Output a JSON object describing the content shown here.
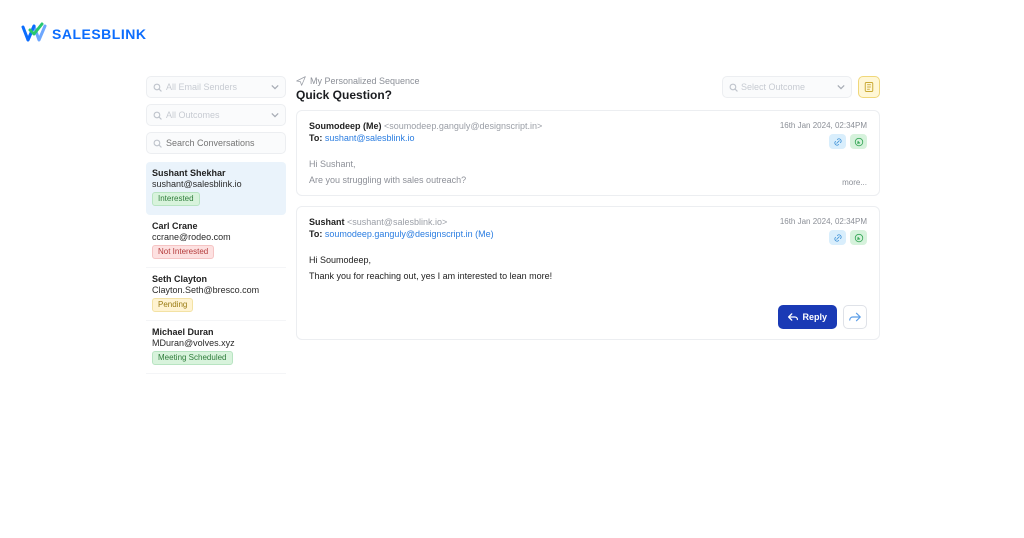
{
  "brand": {
    "name": "SALESBLINK"
  },
  "sidebar": {
    "filter1_placeholder": "All Email Senders",
    "filter2_placeholder": "All Outcomes",
    "search_placeholder": "Search Conversations",
    "contacts": [
      {
        "name": "Sushant Shekhar",
        "email": "sushant@salesblink.io",
        "status": "Interested",
        "status_class": "b-interested",
        "selected": true
      },
      {
        "name": "Carl Crane",
        "email": "ccrane@rodeo.com",
        "status": "Not Interested",
        "status_class": "b-notinterested",
        "selected": false
      },
      {
        "name": "Seth Clayton",
        "email": "Clayton.Seth@bresco.com",
        "status": "Pending",
        "status_class": "b-pending",
        "selected": false
      },
      {
        "name": "Michael Duran",
        "email": "MDuran@volves.xyz",
        "status": "Meeting Scheduled",
        "status_class": "b-meeting",
        "selected": false
      }
    ]
  },
  "main": {
    "breadcrumb": "My Personalized Sequence",
    "subject": "Quick Question?",
    "outcome_placeholder": "Select Outcome",
    "messages": [
      {
        "from_name": "Soumodeep (Me)",
        "from_addr": "<soumodeep.ganguly@designscript.in>",
        "to_label": "To:",
        "to_value": "sushant@salesblink.io",
        "to_suffix": "",
        "timestamp": "16th Jan 2024, 02:34PM",
        "body_preview_line1": "Hi Sushant,",
        "body_preview_line2": "Are you struggling with sales outreach?",
        "more": "more...",
        "collapsed": true
      },
      {
        "from_name": "Sushant",
        "from_addr": "<sushant@salesblink.io>",
        "to_label": "To:",
        "to_value": "soumodeep.ganguly@designscript.in",
        "to_suffix": "(Me)",
        "timestamp": "16th Jan 2024, 02:34PM",
        "body_line1": "Hi Soumodeep,",
        "body_line2": "Thank you for reaching out, yes I am interested to lean more!",
        "collapsed": false
      }
    ],
    "reply_label": "Reply"
  }
}
